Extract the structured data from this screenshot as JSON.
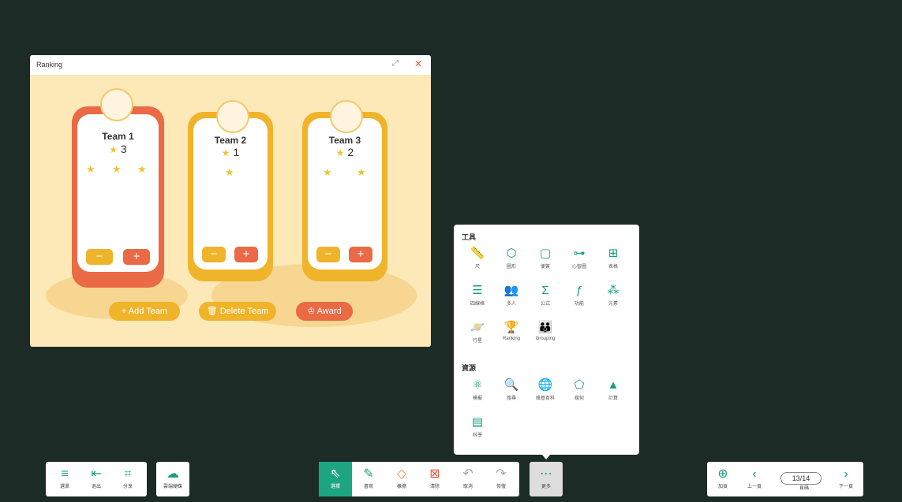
{
  "ranking": {
    "title": "Ranking",
    "maximize_icon": "maximize-icon",
    "close_icon": "close-icon",
    "teams": [
      {
        "name": "Team 1",
        "score": "3",
        "stars": 3,
        "color": "#e96a45"
      },
      {
        "name": "Team 2",
        "score": "1",
        "stars": 1,
        "color": "#f0b42a"
      },
      {
        "name": "Team 3",
        "score": "2",
        "stars": 2,
        "color": "#f0b42a"
      }
    ],
    "minus_label": "−",
    "plus_label": "+",
    "add_team": "+ Add Team",
    "delete_team": "Delete Team",
    "award": "Award",
    "colors": {
      "orange": "#e96a45",
      "yellow": "#f0b42a",
      "bg": "#fde8b7"
    }
  },
  "more_panel": {
    "tools_title": "工具",
    "tools": [
      {
        "label": "尺",
        "icon": "ruler-icon",
        "glyph": "📏"
      },
      {
        "label": "圖形",
        "icon": "shapes-icon",
        "glyph": "⬡"
      },
      {
        "label": "便簽",
        "icon": "note-icon",
        "glyph": "▢"
      },
      {
        "label": "心智圖",
        "icon": "mindmap-icon",
        "glyph": "⊶"
      },
      {
        "label": "表格",
        "icon": "table-icon",
        "glyph": "⊞"
      },
      {
        "label": "四線格",
        "icon": "four-line-icon",
        "glyph": "☰"
      },
      {
        "label": "多人",
        "icon": "multi-user-icon",
        "glyph": "👥"
      },
      {
        "label": "公式",
        "icon": "formula-icon",
        "glyph": "Σ"
      },
      {
        "label": "功能",
        "icon": "function-icon",
        "glyph": "ƒ"
      },
      {
        "label": "元素",
        "icon": "elements-icon",
        "glyph": "⁂"
      },
      {
        "label": "行星",
        "icon": "planet-icon",
        "glyph": "🪐"
      },
      {
        "label": "Ranking",
        "icon": "ranking-icon",
        "glyph": "🏆"
      },
      {
        "label": "Grouping",
        "icon": "grouping-icon",
        "glyph": "👪"
      }
    ],
    "resources_title": "資源",
    "resources": [
      {
        "label": "模擬",
        "icon": "simulation-icon",
        "glyph": "⚛"
      },
      {
        "label": "搜尋",
        "icon": "search-icon",
        "glyph": "🔍"
      },
      {
        "label": "維基百科",
        "icon": "wikipedia-icon",
        "glyph": "🌐"
      },
      {
        "label": "幾何",
        "icon": "geometry-icon",
        "glyph": "⬠"
      },
      {
        "label": "計算",
        "icon": "calculate-icon",
        "glyph": "▲"
      },
      {
        "label": "科學",
        "icon": "science-icon",
        "glyph": "▤"
      }
    ]
  },
  "bottom_left": [
    {
      "label": "選單",
      "icon": "menu-icon",
      "glyph": "≡"
    },
    {
      "label": "退出",
      "icon": "exit-icon",
      "glyph": "⇤"
    },
    {
      "label": "分享",
      "icon": "qr-share-icon",
      "glyph": "⌗"
    }
  ],
  "cloud": {
    "label": "雲端硬碟",
    "icon": "cloud-icon",
    "glyph": "☁"
  },
  "bottom_center": [
    {
      "label": "選擇",
      "icon": "select-cursor-icon",
      "glyph": "⇖",
      "active": true
    },
    {
      "label": "書寫",
      "icon": "pen-icon",
      "glyph": "✎"
    },
    {
      "label": "橡擦",
      "icon": "eraser-icon",
      "glyph": "◇"
    },
    {
      "label": "清除",
      "icon": "clear-icon",
      "glyph": "⊠"
    },
    {
      "label": "取消",
      "icon": "undo-icon",
      "glyph": "↶"
    },
    {
      "label": "恢復",
      "icon": "redo-icon",
      "glyph": "↷"
    }
  ],
  "more": {
    "label": "更多",
    "icon": "more-icon",
    "glyph": "⋯"
  },
  "bottom_right": {
    "add_page": {
      "label": "加頁",
      "icon": "add-page-icon",
      "glyph": "⊕"
    },
    "prev": {
      "label": "上一頁",
      "icon": "chevron-left-icon",
      "glyph": "‹"
    },
    "page": {
      "label": "頁碼",
      "value": "13/14"
    },
    "next": {
      "label": "下一頁",
      "icon": "chevron-right-icon",
      "glyph": "›"
    }
  }
}
